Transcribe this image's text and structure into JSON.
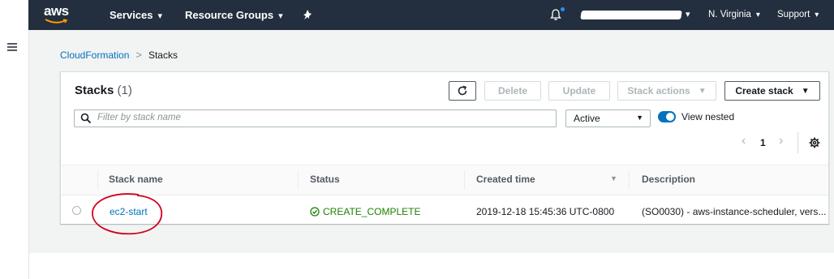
{
  "nav": {
    "logo_text": "aws",
    "services": "Services",
    "resource_groups": "Resource Groups",
    "caret": "▾",
    "region": "N. Virginia",
    "support": "Support"
  },
  "breadcrumb": {
    "parent": "CloudFormation",
    "separator": ">",
    "current": "Stacks"
  },
  "panel": {
    "title": "Stacks",
    "count": "(1)",
    "buttons": {
      "refresh": "C",
      "delete": "Delete",
      "update": "Update",
      "stack_actions": "Stack actions",
      "create_stack": "Create stack"
    },
    "search": {
      "placeholder": "Filter by stack name"
    },
    "filter_select": {
      "value": "Active"
    },
    "view_nested": {
      "label": "View nested",
      "enabled": true
    },
    "pagination": {
      "prev": "‹",
      "page": "1",
      "next": "›"
    }
  },
  "table": {
    "columns": [
      "Stack name",
      "Status",
      "Created time",
      "Description"
    ],
    "rows": [
      {
        "stack_name": "ec2-start",
        "status": "CREATE_COMPLETE",
        "created_time": "2019-12-18 15:45:36 UTC-0800",
        "description": "(SO0030) - aws-instance-scheduler, vers..."
      }
    ]
  },
  "colors": {
    "nav_bg": "#232f3e",
    "link": "#0073bb",
    "success": "#1d8102",
    "annotation": "#d0021b"
  }
}
